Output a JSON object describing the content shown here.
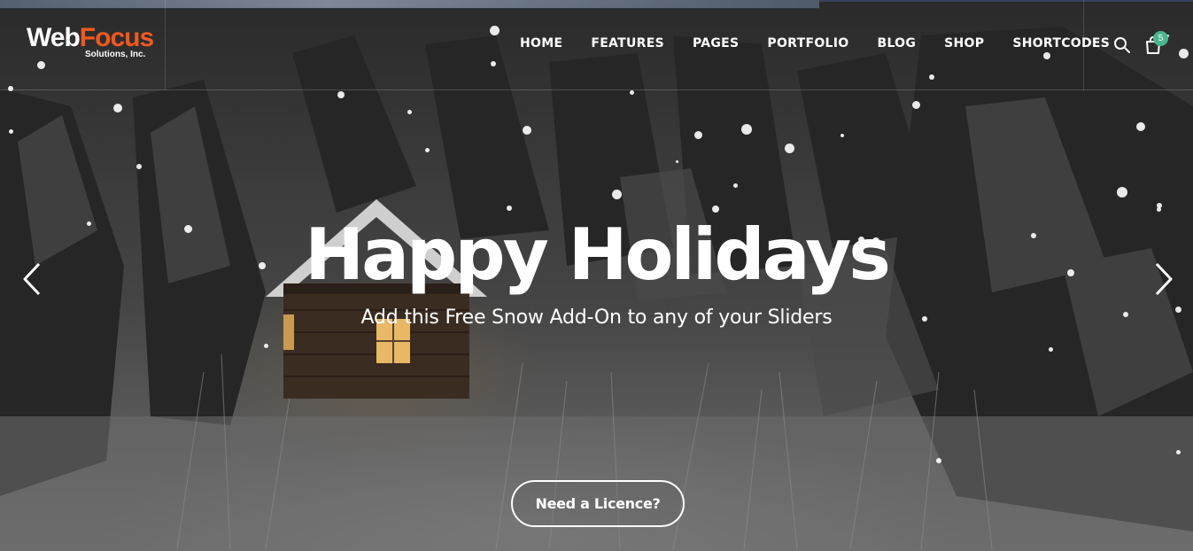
{
  "brand": {
    "name_part1": "Web",
    "name_part2": "Focus",
    "tagline": "Solutions, Inc.",
    "accent_color": "#f0591e"
  },
  "nav": {
    "items": [
      {
        "label": "HOME"
      },
      {
        "label": "FEATURES"
      },
      {
        "label": "PAGES"
      },
      {
        "label": "PORTFOLIO"
      },
      {
        "label": "BLOG"
      },
      {
        "label": "SHOP"
      },
      {
        "label": "SHORTCODES"
      }
    ]
  },
  "header_actions": {
    "search_icon": "search-icon",
    "cart_icon": "shopping-bag-icon",
    "cart_count": "5",
    "badge_color": "#4bb58f"
  },
  "hero": {
    "title": "Happy Holidays",
    "subtitle": "Add this Free Snow Add-On to any of your Sliders",
    "cta_label": "Need a Licence?",
    "prev_icon": "chevron-left-icon",
    "next_icon": "chevron-right-icon"
  }
}
